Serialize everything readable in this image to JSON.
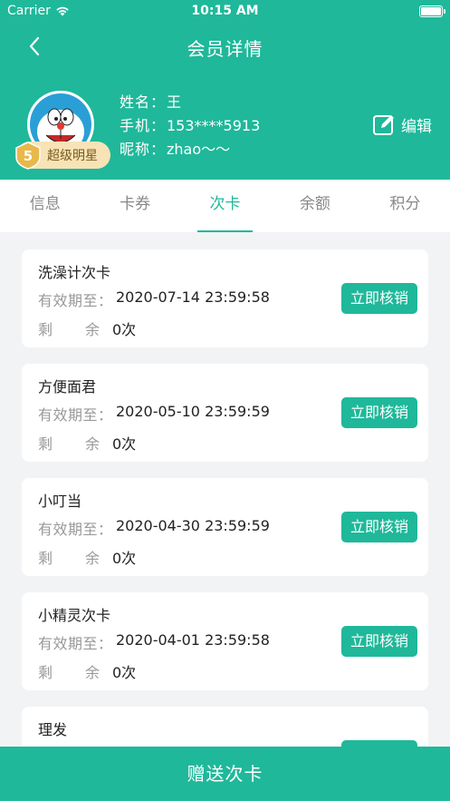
{
  "status_bar": {
    "carrier": "Carrier",
    "time": "10:15 AM"
  },
  "nav": {
    "title": "会员详情"
  },
  "member": {
    "name_label": "姓名：",
    "name": "王",
    "phone_label": "手机：",
    "phone": "153****5913",
    "nickname_label": "昵称：",
    "nickname": "zhao～～",
    "badge": "超级明星",
    "badge_level": "5",
    "edit_label": "编辑"
  },
  "tabs": [
    {
      "label": "信息"
    },
    {
      "label": "卡券"
    },
    {
      "label": "次卡"
    },
    {
      "label": "余额"
    },
    {
      "label": "积分"
    }
  ],
  "active_tab": "次卡",
  "card_labels": {
    "valid_until": "有效期至：",
    "remaining_a": "剩",
    "remaining_b": "余"
  },
  "cards": [
    {
      "name": "洗澡计次卡",
      "valid_until": "2020-07-14 23:59:58",
      "remaining": "0次",
      "action": "立即核销"
    },
    {
      "name": "方便面君",
      "valid_until": "2020-05-10 23:59:59",
      "remaining": "0次",
      "action": "立即核销"
    },
    {
      "name": "小叮当",
      "valid_until": "2020-04-30 23:59:59",
      "remaining": "0次",
      "action": "立即核销"
    },
    {
      "name": "小精灵次卡",
      "valid_until": "2020-04-01 23:59:58",
      "remaining": "0次",
      "action": "立即核销"
    },
    {
      "name": "理发",
      "valid_until": "",
      "remaining": "",
      "action": ""
    }
  ],
  "bottom_action": "赠送次卡",
  "colors": {
    "primary": "#1fb89a",
    "background": "#f2f3f5",
    "badge": "#f7e3b5"
  },
  "icons": [
    "wifi-icon",
    "battery-icon",
    "back-arrow-icon",
    "edit-icon",
    "avatar"
  ]
}
